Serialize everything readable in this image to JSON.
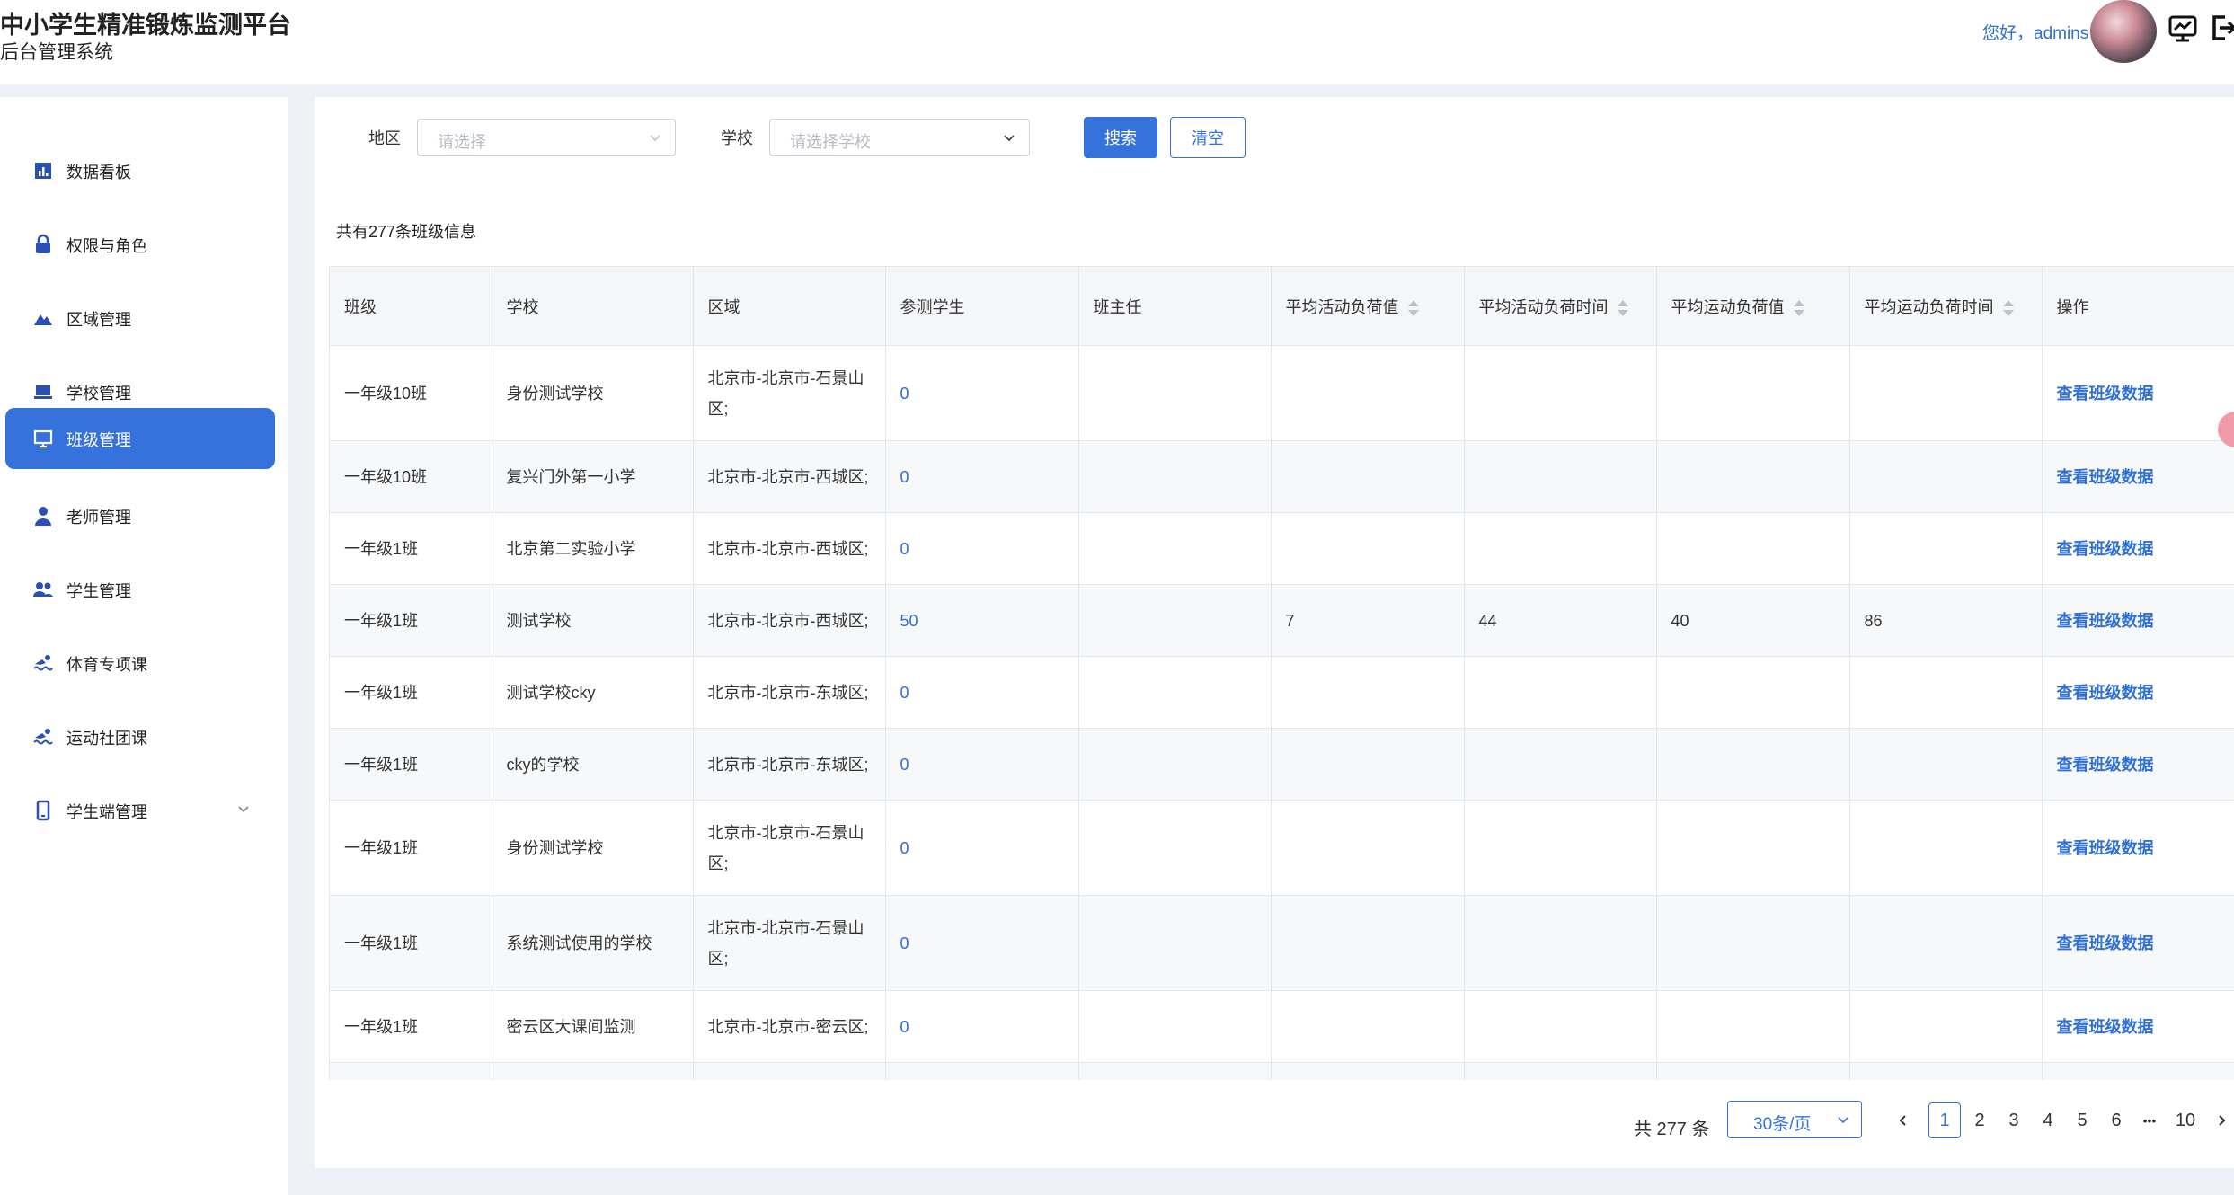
{
  "header": {
    "title": "中小学生精准锻炼监测平台",
    "subtitle": "后台管理系统",
    "greeting": "您好，admins"
  },
  "sidebar": {
    "items": [
      {
        "label": "数据看板",
        "icon": "bar-chart-icon"
      },
      {
        "label": "权限与角色",
        "icon": "lock-icon"
      },
      {
        "label": "区域管理",
        "icon": "mountain-icon"
      },
      {
        "label": "学校管理",
        "icon": "laptop-icon"
      },
      {
        "label": "班级管理",
        "icon": "monitor-icon",
        "active": true
      },
      {
        "label": "老师管理",
        "icon": "teacher-icon"
      },
      {
        "label": "学生管理",
        "icon": "users-icon"
      },
      {
        "label": "体育专项课",
        "icon": "swim-icon"
      },
      {
        "label": "运动社团课",
        "icon": "swim-icon"
      },
      {
        "label": "学生端管理",
        "icon": "phone-icon",
        "expandable": true
      }
    ]
  },
  "filters": {
    "region_label": "地区",
    "region_placeholder": "请选择",
    "school_label": "学校",
    "school_placeholder": "请选择学校",
    "search_label": "搜索",
    "clear_label": "清空"
  },
  "summary": "共有277条班级信息",
  "table": {
    "columns": [
      "班级",
      "学校",
      "区域",
      "参测学生",
      "班主任",
      "平均活动负荷值",
      "平均活动负荷时间",
      "平均运动负荷值",
      "平均运动负荷时间",
      "操作"
    ],
    "action_label": "查看班级数据",
    "rows": [
      {
        "class": "一年级10班",
        "school": "身份测试学校",
        "region": [
          "北京市-北京市-石景山",
          "区;"
        ],
        "students": "0",
        "teacher": "",
        "act_val": "",
        "act_time": "",
        "sport_val": "",
        "sport_time": ""
      },
      {
        "class": "一年级10班",
        "school": "复兴门外第一小学",
        "region": [
          "北京市-北京市-西城区;"
        ],
        "students": "0",
        "teacher": "",
        "act_val": "",
        "act_time": "",
        "sport_val": "",
        "sport_time": ""
      },
      {
        "class": "一年级1班",
        "school": "北京第二实验小学",
        "region": [
          "北京市-北京市-西城区;"
        ],
        "students": "0",
        "teacher": "",
        "act_val": "",
        "act_time": "",
        "sport_val": "",
        "sport_time": ""
      },
      {
        "class": "一年级1班",
        "school": "测试学校",
        "region": [
          "北京市-北京市-西城区;"
        ],
        "students": "50",
        "teacher": "",
        "act_val": "7",
        "act_time": "44",
        "sport_val": "40",
        "sport_time": "86"
      },
      {
        "class": "一年级1班",
        "school": "测试学校cky",
        "region": [
          "北京市-北京市-东城区;"
        ],
        "students": "0",
        "teacher": "",
        "act_val": "",
        "act_time": "",
        "sport_val": "",
        "sport_time": ""
      },
      {
        "class": "一年级1班",
        "school": "cky的学校",
        "region": [
          "北京市-北京市-东城区;"
        ],
        "students": "0",
        "teacher": "",
        "act_val": "",
        "act_time": "",
        "sport_val": "",
        "sport_time": ""
      },
      {
        "class": "一年级1班",
        "school": "身份测试学校",
        "region": [
          "北京市-北京市-石景山",
          "区;"
        ],
        "students": "0",
        "teacher": "",
        "act_val": "",
        "act_time": "",
        "sport_val": "",
        "sport_time": ""
      },
      {
        "class": "一年级1班",
        "school": "系统测试使用的学校",
        "region": [
          "北京市-北京市-石景山",
          "区;"
        ],
        "students": "0",
        "teacher": "",
        "act_val": "",
        "act_time": "",
        "sport_val": "",
        "sport_time": ""
      },
      {
        "class": "一年级1班",
        "school": "密云区大课间监测",
        "region": [
          "北京市-北京市-密云区;"
        ],
        "students": "0",
        "teacher": "",
        "act_val": "",
        "act_time": "",
        "sport_val": "",
        "sport_time": ""
      },
      {
        "class": "",
        "school": "",
        "region": [
          ""
        ],
        "students": "",
        "teacher": "",
        "act_val": "",
        "act_time": "",
        "sport_val": "",
        "sport_time": ""
      }
    ]
  },
  "pagination": {
    "total": "共 277 条",
    "page_size": "30条/页",
    "pages": [
      "1",
      "2",
      "3",
      "4",
      "5",
      "6"
    ],
    "ellipsis": "•••",
    "last": "10",
    "current": "1"
  },
  "colors": {
    "primary": "#3572dc",
    "link": "#2f6fd6",
    "background": "#eef1f7"
  }
}
